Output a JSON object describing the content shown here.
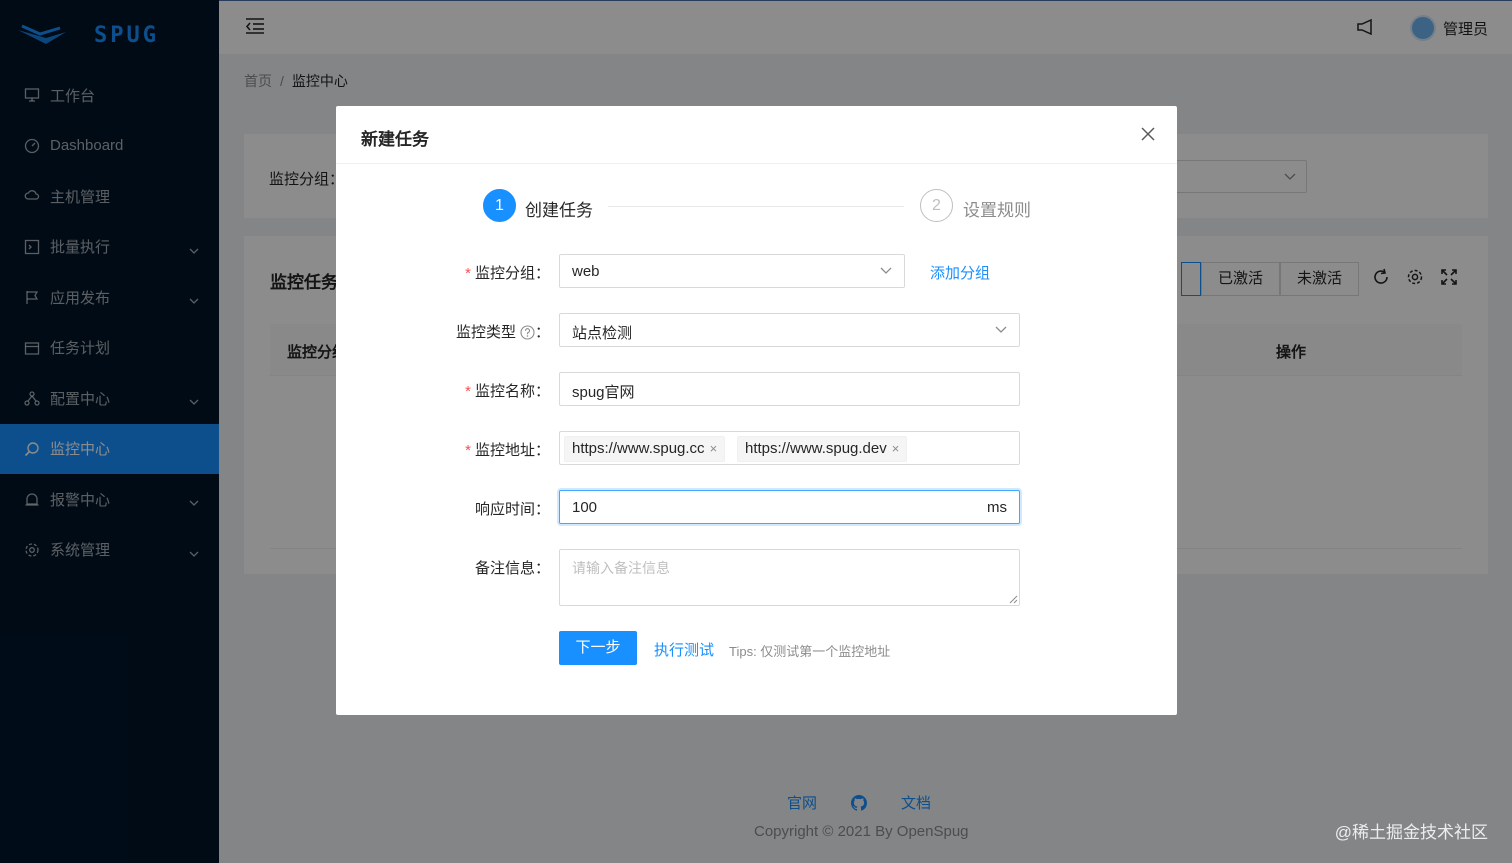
{
  "app": {
    "logo_text": "SPUG"
  },
  "sidebar": {
    "items": [
      {
        "label": "工作台",
        "icon": "desktop-icon",
        "has_arrow": false
      },
      {
        "label": "Dashboard",
        "icon": "dashboard-icon",
        "has_arrow": false
      },
      {
        "label": "主机管理",
        "icon": "cloud-server-icon",
        "has_arrow": false
      },
      {
        "label": "批量执行",
        "icon": "code-icon",
        "has_arrow": true
      },
      {
        "label": "应用发布",
        "icon": "flag-icon",
        "has_arrow": true
      },
      {
        "label": "任务计划",
        "icon": "schedule-icon",
        "has_arrow": false
      },
      {
        "label": "配置中心",
        "icon": "deployment-icon",
        "has_arrow": true
      },
      {
        "label": "监控中心",
        "icon": "monitor-icon",
        "has_arrow": false,
        "active": true
      },
      {
        "label": "报警中心",
        "icon": "alert-icon",
        "has_arrow": true
      },
      {
        "label": "系统管理",
        "icon": "setting-icon",
        "has_arrow": true
      }
    ]
  },
  "header": {
    "user_name": "管理员"
  },
  "breadcrumb": {
    "home": "首页",
    "separator": "/",
    "current": "监控中心"
  },
  "background": {
    "filter_label": "监控分组：",
    "table_title": "监控任务",
    "status_buttons": [
      "已激活",
      "未激活"
    ],
    "table_head": {
      "col1": "监控分组",
      "col_action": "操作"
    }
  },
  "footer": {
    "links": [
      "官网",
      "文档"
    ],
    "github_icon": "github-icon",
    "copyright": "Copyright © 2021 By OpenSpug"
  },
  "watermark": "@稀土掘金技术社区",
  "modal": {
    "title": "新建任务",
    "steps": [
      {
        "number": "1",
        "title": "创建任务",
        "status": "process"
      },
      {
        "number": "2",
        "title": "设置规则",
        "status": "wait"
      }
    ],
    "form": {
      "group": {
        "label": "监控分组：",
        "value": "web",
        "add_link": "添加分组",
        "required": true
      },
      "type": {
        "label": "监控类型",
        "colon": "：",
        "value": "站点检测"
      },
      "name": {
        "label": "监控名称：",
        "value": "spug官网",
        "required": true
      },
      "address": {
        "label": "监控地址：",
        "tags": [
          "https://www.spug.cc",
          "https://www.spug.dev"
        ],
        "required": true
      },
      "timeout": {
        "label": "响应时间：",
        "value": "100",
        "suffix": "ms"
      },
      "desc": {
        "label": "备注信息：",
        "placeholder": "请输入备注信息"
      }
    },
    "actions": {
      "next": "下一步",
      "test": "执行测试",
      "tips": "Tips: 仅测试第一个监控地址"
    }
  },
  "colors": {
    "primary": "#1890ff",
    "sidebar_bg": "#001529",
    "required": "#ff4d4f"
  }
}
